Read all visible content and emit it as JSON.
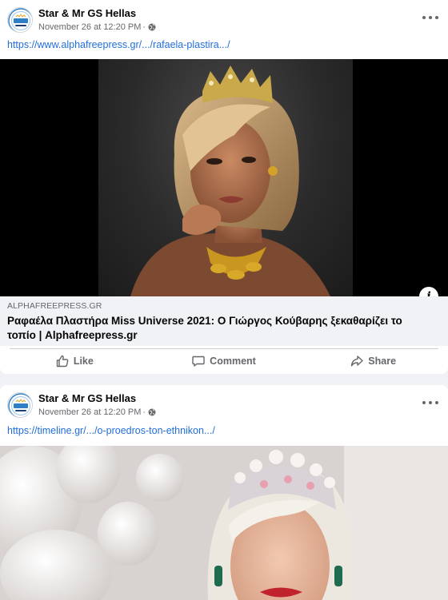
{
  "posts": [
    {
      "page_name": "Star & Mr GS Hellas",
      "timestamp": "November 26 at 12:20 PM",
      "separator": "·",
      "link_url": "https://www.alphafreepress.gr/.../rafaela-plastira.../",
      "preview_domain": "ALPHAFREEPRESS.GR",
      "preview_title": "Ραφαέλα Πλαστήρα Miss Universe 2021: Ο Γιώργος Κούβαρης ξεκαθαρίζει το τοπίο | Alphafreepress.gr",
      "info_glyph": "i",
      "actions": {
        "like": "Like",
        "comment": "Comment",
        "share": "Share"
      }
    },
    {
      "page_name": "Star & Mr GS Hellas",
      "timestamp": "November 26 at 12:20 PM",
      "separator": "·",
      "link_url": "https://timeline.gr/.../o-proedros-ton-ethnikon.../"
    }
  ],
  "icons": {
    "more": "more-horizontal-icon",
    "globe": "globe-icon",
    "info": "info-icon",
    "like": "thumbs-up-icon",
    "comment": "comment-bubble-icon",
    "share": "share-arrow-icon"
  },
  "colors": {
    "link": "#216fdb",
    "muted": "#65676b",
    "feed_background": "#f0f2f5",
    "preview_background": "#f0f2f5"
  }
}
